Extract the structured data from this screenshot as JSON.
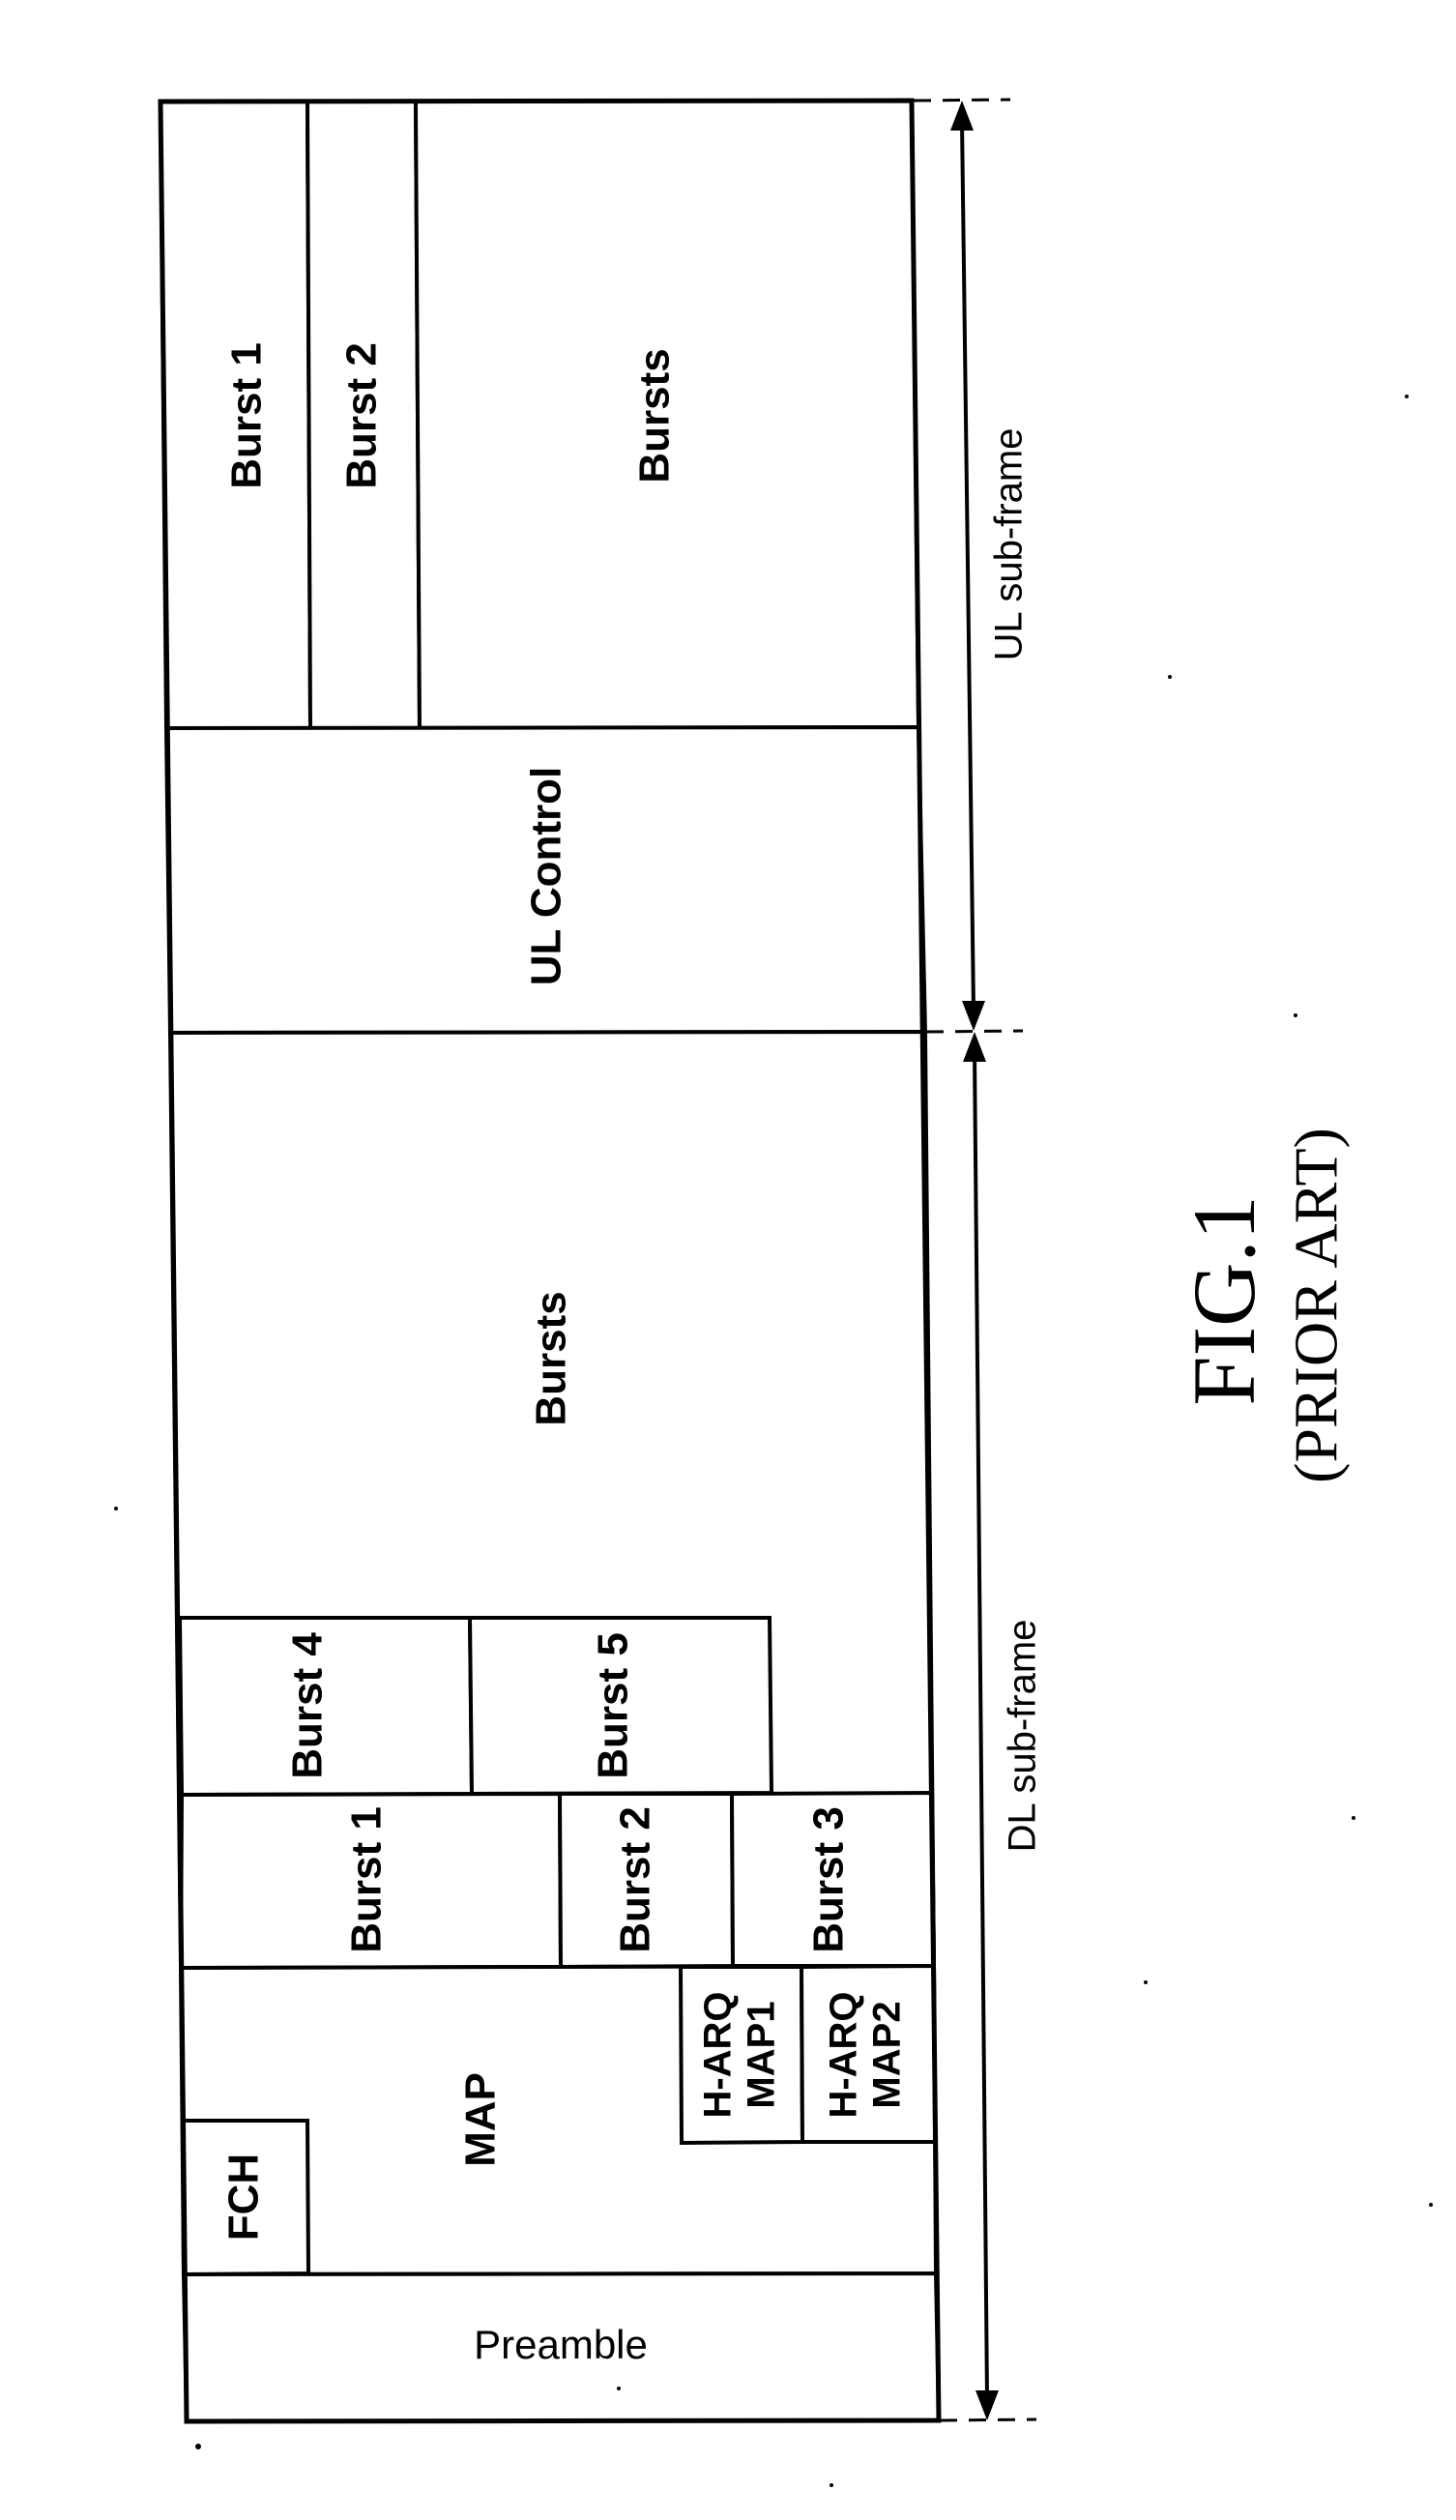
{
  "figure": {
    "title": "FIG.1",
    "subtitle": "(PRIOR ART)"
  },
  "frame": {
    "ul_subframe": {
      "label": "UL sub-frame",
      "bursts": [
        "Burst 1",
        "Burst 2",
        "Bursts"
      ],
      "control": "UL Control"
    },
    "dl_subframe": {
      "label": "DL sub-frame",
      "bursts_area": "Bursts",
      "burst_row_top": [
        "Burst 4",
        "Burst 5"
      ],
      "burst_row_bottom": [
        "Burst 1",
        "Burst 2",
        "Burst 3"
      ],
      "map": "MAP",
      "fch": "FCH",
      "harq_map1": [
        "H-ARQ",
        "MAP1"
      ],
      "harq_map2": [
        "H-ARQ",
        "MAP2"
      ],
      "preamble": "Preamble"
    }
  },
  "icons": {
    "ul_dimension_arrow": "double-headed-arrow",
    "dl_dimension_arrow": "double-headed-arrow"
  }
}
